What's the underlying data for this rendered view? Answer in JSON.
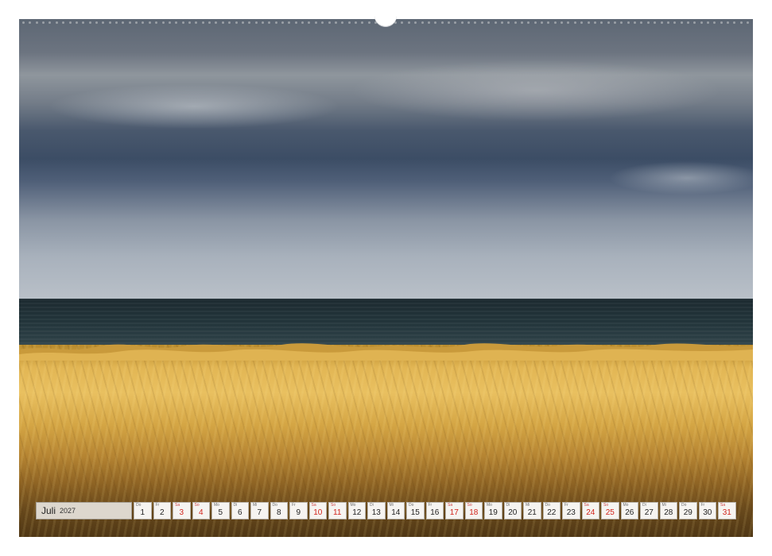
{
  "calendar": {
    "month": "Juli",
    "year": "2027",
    "weekend_color": "#d2231b",
    "days": [
      {
        "wd": "Do",
        "num": "1",
        "weekend": false
      },
      {
        "wd": "Fr",
        "num": "2",
        "weekend": false
      },
      {
        "wd": "Sa",
        "num": "3",
        "weekend": true
      },
      {
        "wd": "So",
        "num": "4",
        "weekend": true
      },
      {
        "wd": "Mo",
        "num": "5",
        "weekend": false
      },
      {
        "wd": "Di",
        "num": "6",
        "weekend": false
      },
      {
        "wd": "Mi",
        "num": "7",
        "weekend": false
      },
      {
        "wd": "Do",
        "num": "8",
        "weekend": false
      },
      {
        "wd": "Fr",
        "num": "9",
        "weekend": false
      },
      {
        "wd": "Sa",
        "num": "10",
        "weekend": true
      },
      {
        "wd": "So",
        "num": "11",
        "weekend": true
      },
      {
        "wd": "Mo",
        "num": "12",
        "weekend": false
      },
      {
        "wd": "Di",
        "num": "13",
        "weekend": false
      },
      {
        "wd": "Mi",
        "num": "14",
        "weekend": false
      },
      {
        "wd": "Do",
        "num": "15",
        "weekend": false
      },
      {
        "wd": "Fr",
        "num": "16",
        "weekend": false
      },
      {
        "wd": "Sa",
        "num": "17",
        "weekend": true
      },
      {
        "wd": "So",
        "num": "18",
        "weekend": true
      },
      {
        "wd": "Mo",
        "num": "19",
        "weekend": false
      },
      {
        "wd": "Di",
        "num": "20",
        "weekend": false
      },
      {
        "wd": "Mi",
        "num": "21",
        "weekend": false
      },
      {
        "wd": "Do",
        "num": "22",
        "weekend": false
      },
      {
        "wd": "Fr",
        "num": "23",
        "weekend": false
      },
      {
        "wd": "Sa",
        "num": "24",
        "weekend": true
      },
      {
        "wd": "So",
        "num": "25",
        "weekend": true
      },
      {
        "wd": "Mo",
        "num": "26",
        "weekend": false
      },
      {
        "wd": "Di",
        "num": "27",
        "weekend": false
      },
      {
        "wd": "Mi",
        "num": "28",
        "weekend": false
      },
      {
        "wd": "Do",
        "num": "29",
        "weekend": false
      },
      {
        "wd": "Fr",
        "num": "30",
        "weekend": false
      },
      {
        "wd": "Sa",
        "num": "31",
        "weekend": true
      }
    ]
  }
}
